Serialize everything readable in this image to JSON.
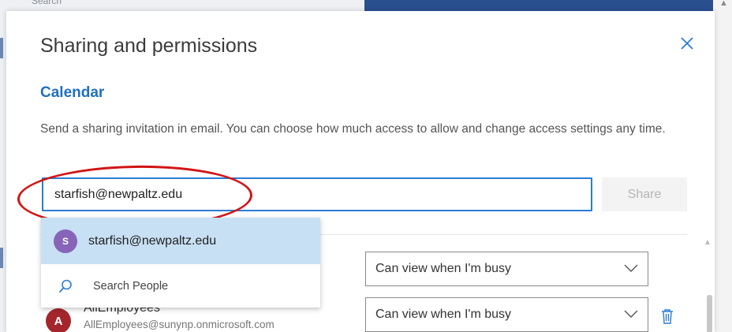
{
  "dialog": {
    "title": "Sharing and permissions",
    "section_title": "Calendar",
    "description": "Send a sharing invitation in email. You can choose how much access to allow and change access settings any time."
  },
  "share_field": {
    "value": "starfish@newpaltz.edu",
    "button_label": "Share"
  },
  "suggestions": {
    "item": {
      "avatar_letter": "S",
      "email": "starfish@newpaltz.edu"
    },
    "search_people_label": "Search People"
  },
  "permissions": [
    {
      "level": "Can view when I'm busy"
    },
    {
      "name": "AllEmployees",
      "email": "AllEmployees@sunynp.onmicrosoft.com",
      "avatar_letter": "A",
      "level": "Can view when I'm busy"
    }
  ],
  "background": {
    "search_text": "Search"
  },
  "colors": {
    "accent": "#2b7cd3",
    "section_title": "#1f6fc0",
    "annotation": "#d21414",
    "suggestion_highlight": "#c7e0f4",
    "avatar_s": "#8764b8",
    "avatar_a": "#a4262c"
  },
  "icons": {
    "close": "close-icon",
    "search": "search-icon",
    "chevron": "chevron-down-icon",
    "delete": "trash-icon"
  }
}
